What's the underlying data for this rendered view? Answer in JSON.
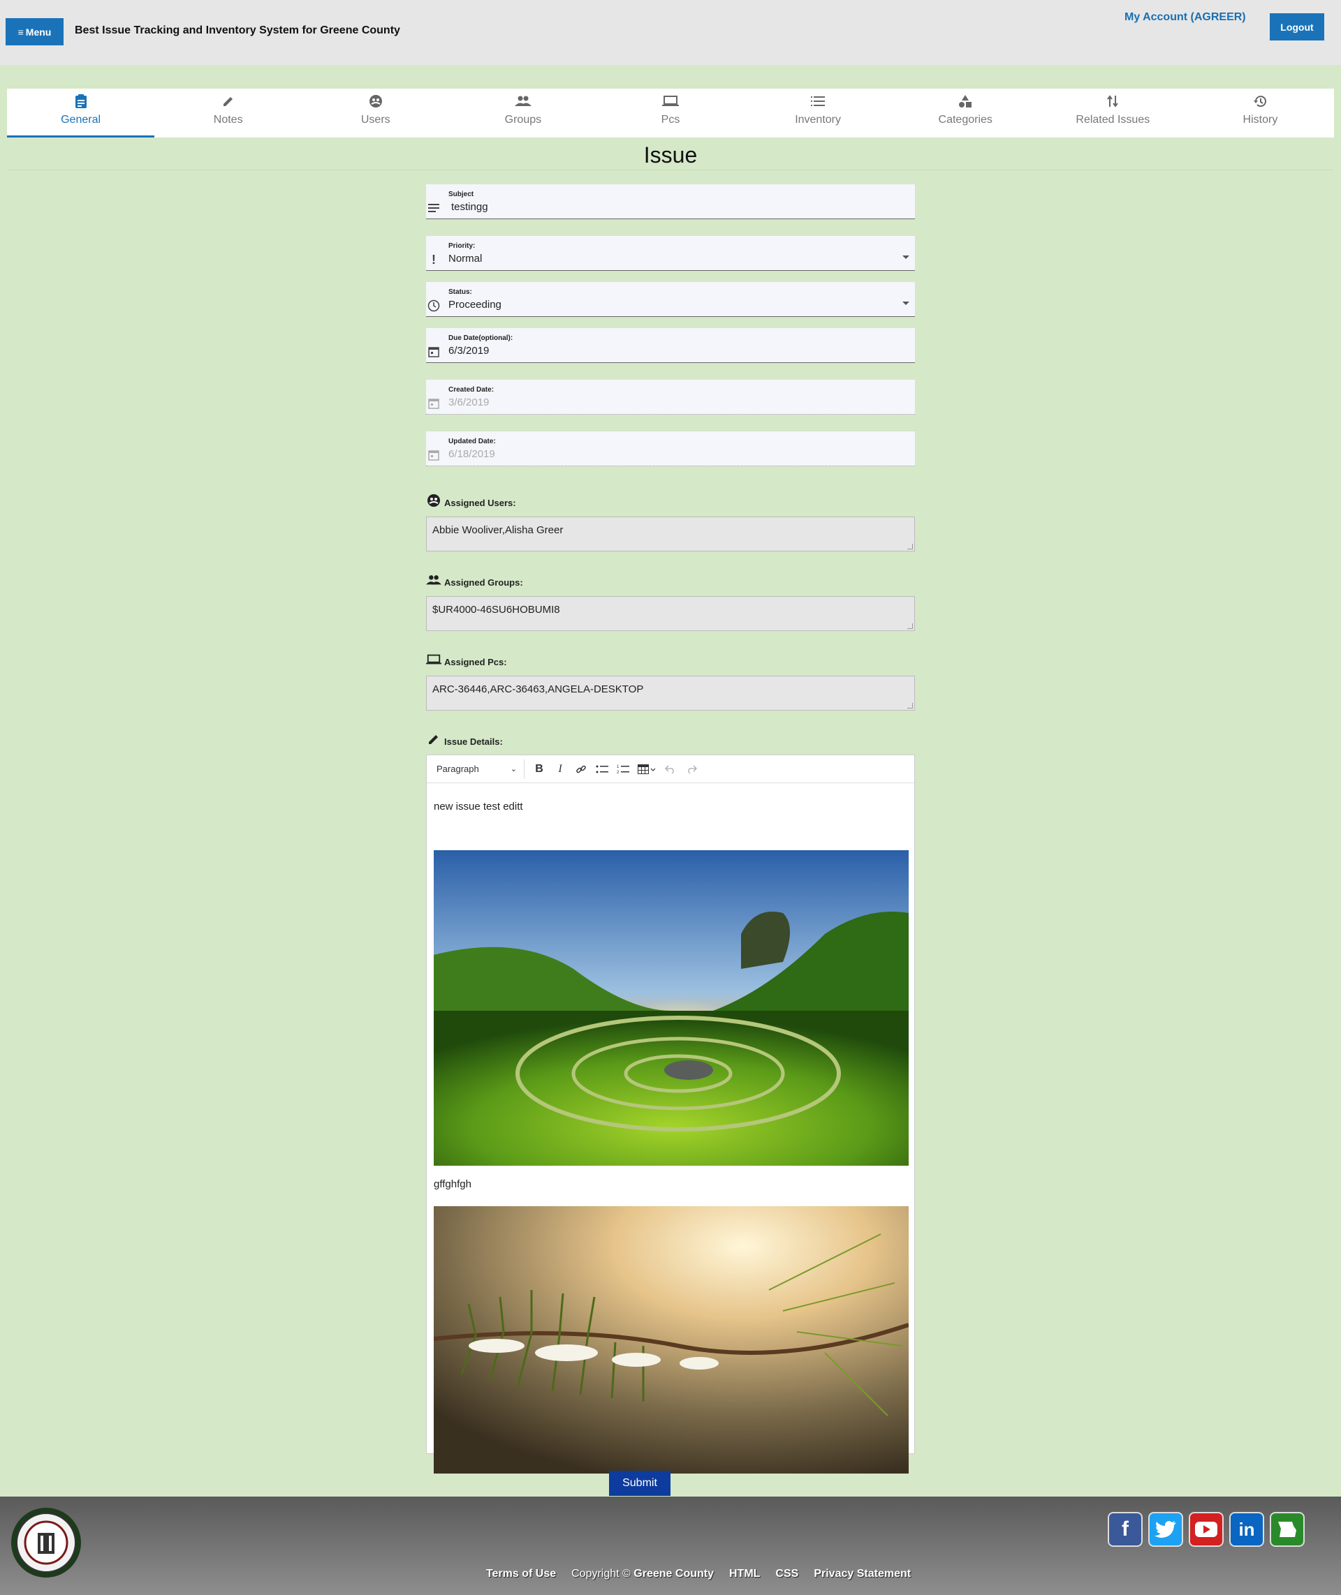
{
  "header": {
    "menu_label": "Menu",
    "app_title": "Best Issue Tracking and Inventory System for Greene County",
    "account_label": "My Account (AGREER)",
    "logout_label": "Logout",
    "accent_color": "#1a73b9"
  },
  "tabs": [
    {
      "label": "General",
      "icon": "clipboard-icon",
      "active": true
    },
    {
      "label": "Notes",
      "icon": "pencil-icon"
    },
    {
      "label": "Users",
      "icon": "user-globe-icon"
    },
    {
      "label": "Groups",
      "icon": "group-icon"
    },
    {
      "label": "Pcs",
      "icon": "laptop-icon"
    },
    {
      "label": "Inventory",
      "icon": "list-icon"
    },
    {
      "label": "Categories",
      "icon": "shapes-icon"
    },
    {
      "label": "Related Issues",
      "icon": "swap-vertical-icon"
    },
    {
      "label": "History",
      "icon": "history-icon"
    }
  ],
  "page_title": "Issue",
  "form": {
    "subject": {
      "label": "Subject",
      "value": "testingg"
    },
    "priority": {
      "label": "Priority:",
      "value": "Normal"
    },
    "status": {
      "label": "Status:",
      "value": "Proceeding"
    },
    "due_date": {
      "label": "Due Date(optional):",
      "value": "6/3/2019"
    },
    "created_date": {
      "label": "Created Date:",
      "value": "3/6/2019"
    },
    "updated_date": {
      "label": "Updated Date:",
      "value": "6/18/2019"
    },
    "assigned_users": {
      "label": "Assigned Users:",
      "value": "Abbie Wooliver,Alisha Greer"
    },
    "assigned_groups": {
      "label": "Assigned Groups:",
      "value": "$UR4000-46SU6HOBUMI8"
    },
    "assigned_pcs": {
      "label": "Assigned Pcs:",
      "value": "ARC-36446,ARC-36463,ANGELA-DESKTOP"
    },
    "issue_details": {
      "label": "Issue Details:"
    }
  },
  "editor": {
    "format_select": "Paragraph",
    "line1": "new issue test editt",
    "line2": "gffghfgh",
    "images": [
      "landscape-sunset-valley-photo",
      "snowy-pine-branch-photo"
    ]
  },
  "submit_label": "Submit",
  "footer": {
    "links": [
      "Terms of Use",
      "Copyright ©",
      "Greene County",
      "HTML",
      "CSS",
      "Privacy Statement"
    ],
    "socials": [
      "facebook-icon",
      "twitter-icon",
      "youtube-icon",
      "linkedin-icon",
      "missouri-icon"
    ]
  }
}
